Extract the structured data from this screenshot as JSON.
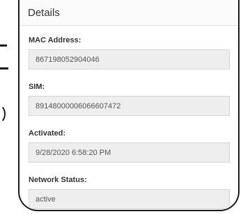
{
  "panel": {
    "title": "Details"
  },
  "fields": [
    {
      "label": "MAC Address:",
      "value": "867198052904046"
    },
    {
      "label": "SIM:",
      "value": "89148000006066607472"
    },
    {
      "label": "Activated:",
      "value": "9/28/2020 6:58:20 PM"
    },
    {
      "label": "Network Status:",
      "value": "active"
    }
  ]
}
